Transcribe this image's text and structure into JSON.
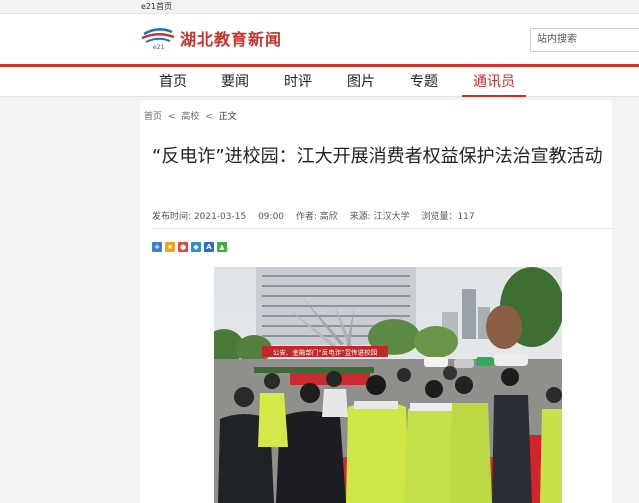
{
  "topbar": {
    "home_link": "e21首页"
  },
  "header": {
    "logo_text": "湖北教育新闻",
    "logo_mark_text": "e21",
    "search_placeholder": "站内搜索"
  },
  "nav": {
    "items": [
      {
        "label": "首页"
      },
      {
        "label": "要闻"
      },
      {
        "label": "时评"
      },
      {
        "label": "图片"
      },
      {
        "label": "专题"
      },
      {
        "label": "通讯员",
        "active": true
      }
    ]
  },
  "breadcrumb": {
    "home": "首页",
    "sep1": "<",
    "section": "高校",
    "sep2": "<",
    "current": "正文"
  },
  "article": {
    "title": "“反电诈”进校园：江大开展消费者权益保护法治宣教活动",
    "publish_time": "发布时间: 2021-03-15",
    "time": "09:00",
    "author": "作者: 高欣",
    "source": "来源: 江汉大学",
    "views": "浏览量：117"
  },
  "share_icons": [
    "share-qzone-icon",
    "share-weibo-icon",
    "share-tencent-icon",
    "share-renren-icon",
    "share-douban-icon",
    "share-wechat-icon"
  ],
  "photo": {
    "banner_text": "公安、金融部门“反电诈”宣传进校园"
  },
  "colors": {
    "accent": "#c8312b",
    "nav_red_line": "#d8312b"
  }
}
